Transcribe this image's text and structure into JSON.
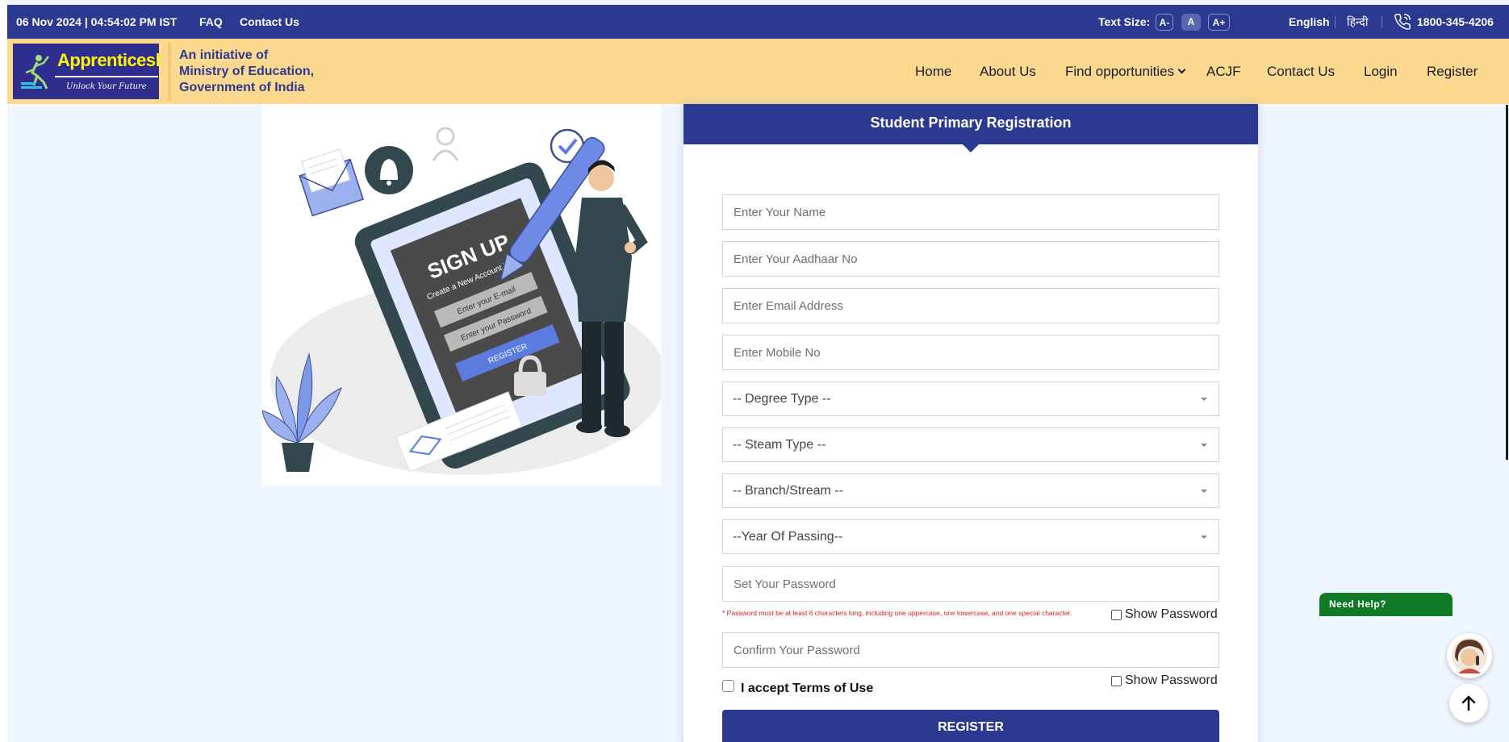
{
  "topbar": {
    "datetime": "06 Nov 2024 | 04:54:02 PM IST",
    "faq": "FAQ",
    "contact": "Contact Us",
    "text_size_label": "Text Size:",
    "size_decrease": "A-",
    "size_normal": "A",
    "size_increase": "A+",
    "lang_english": "English",
    "lang_hindi": "हिन्दी",
    "phone": "1800-345-4206",
    "icons": [
      "phone-icon"
    ]
  },
  "header": {
    "logo_title": "Apprenticeship",
    "logo_tagline": "Unlock Your Future",
    "initiative_lines": [
      "An initiative of",
      "Ministry of Education,",
      "Government of India"
    ],
    "nav": {
      "home": "Home",
      "about": "About Us",
      "find": "Find opportunities",
      "acjf": "ACJF",
      "contact": "Contact Us",
      "login": "Login",
      "register": "Register"
    }
  },
  "illustration": {
    "sign_up": "SIGN UP",
    "subtitle": "Create a New Account is Free",
    "email_field": "Enter your E-mail",
    "password_field": "Enter your Password",
    "register": "REGISTER"
  },
  "form": {
    "title": "Student Primary Registration",
    "name_placeholder": "Enter Your Name",
    "aadhaar_placeholder": "Enter Your Aadhaar No",
    "email_placeholder": "Enter Email Address",
    "mobile_placeholder": "Enter Mobile No",
    "degree_type": "-- Degree Type --",
    "steam_type": "-- Steam Type --",
    "branch": "-- Branch/Stream --",
    "year_of_passing": "--Year Of Passing--",
    "password_placeholder": "Set Your Password",
    "password_note": "* Password must be at least 6 characters long, including one uppercase, one lowercase, and one special character.",
    "show_password": "Show Password",
    "confirm_placeholder": "Confirm Your Password",
    "show_password_2": "Show Password",
    "terms": "I accept Terms of Use",
    "register_button": "REGISTER"
  },
  "widgets": {
    "need_help": "Need Help?",
    "icons": [
      "assistant-avatar",
      "arrow-up-icon"
    ]
  },
  "colors": {
    "primary": "#2b3990",
    "header_bg": "#fcd98f",
    "page_bg": "#f0f6ff",
    "help_green": "#117a26",
    "error_red": "#d61f1f"
  }
}
